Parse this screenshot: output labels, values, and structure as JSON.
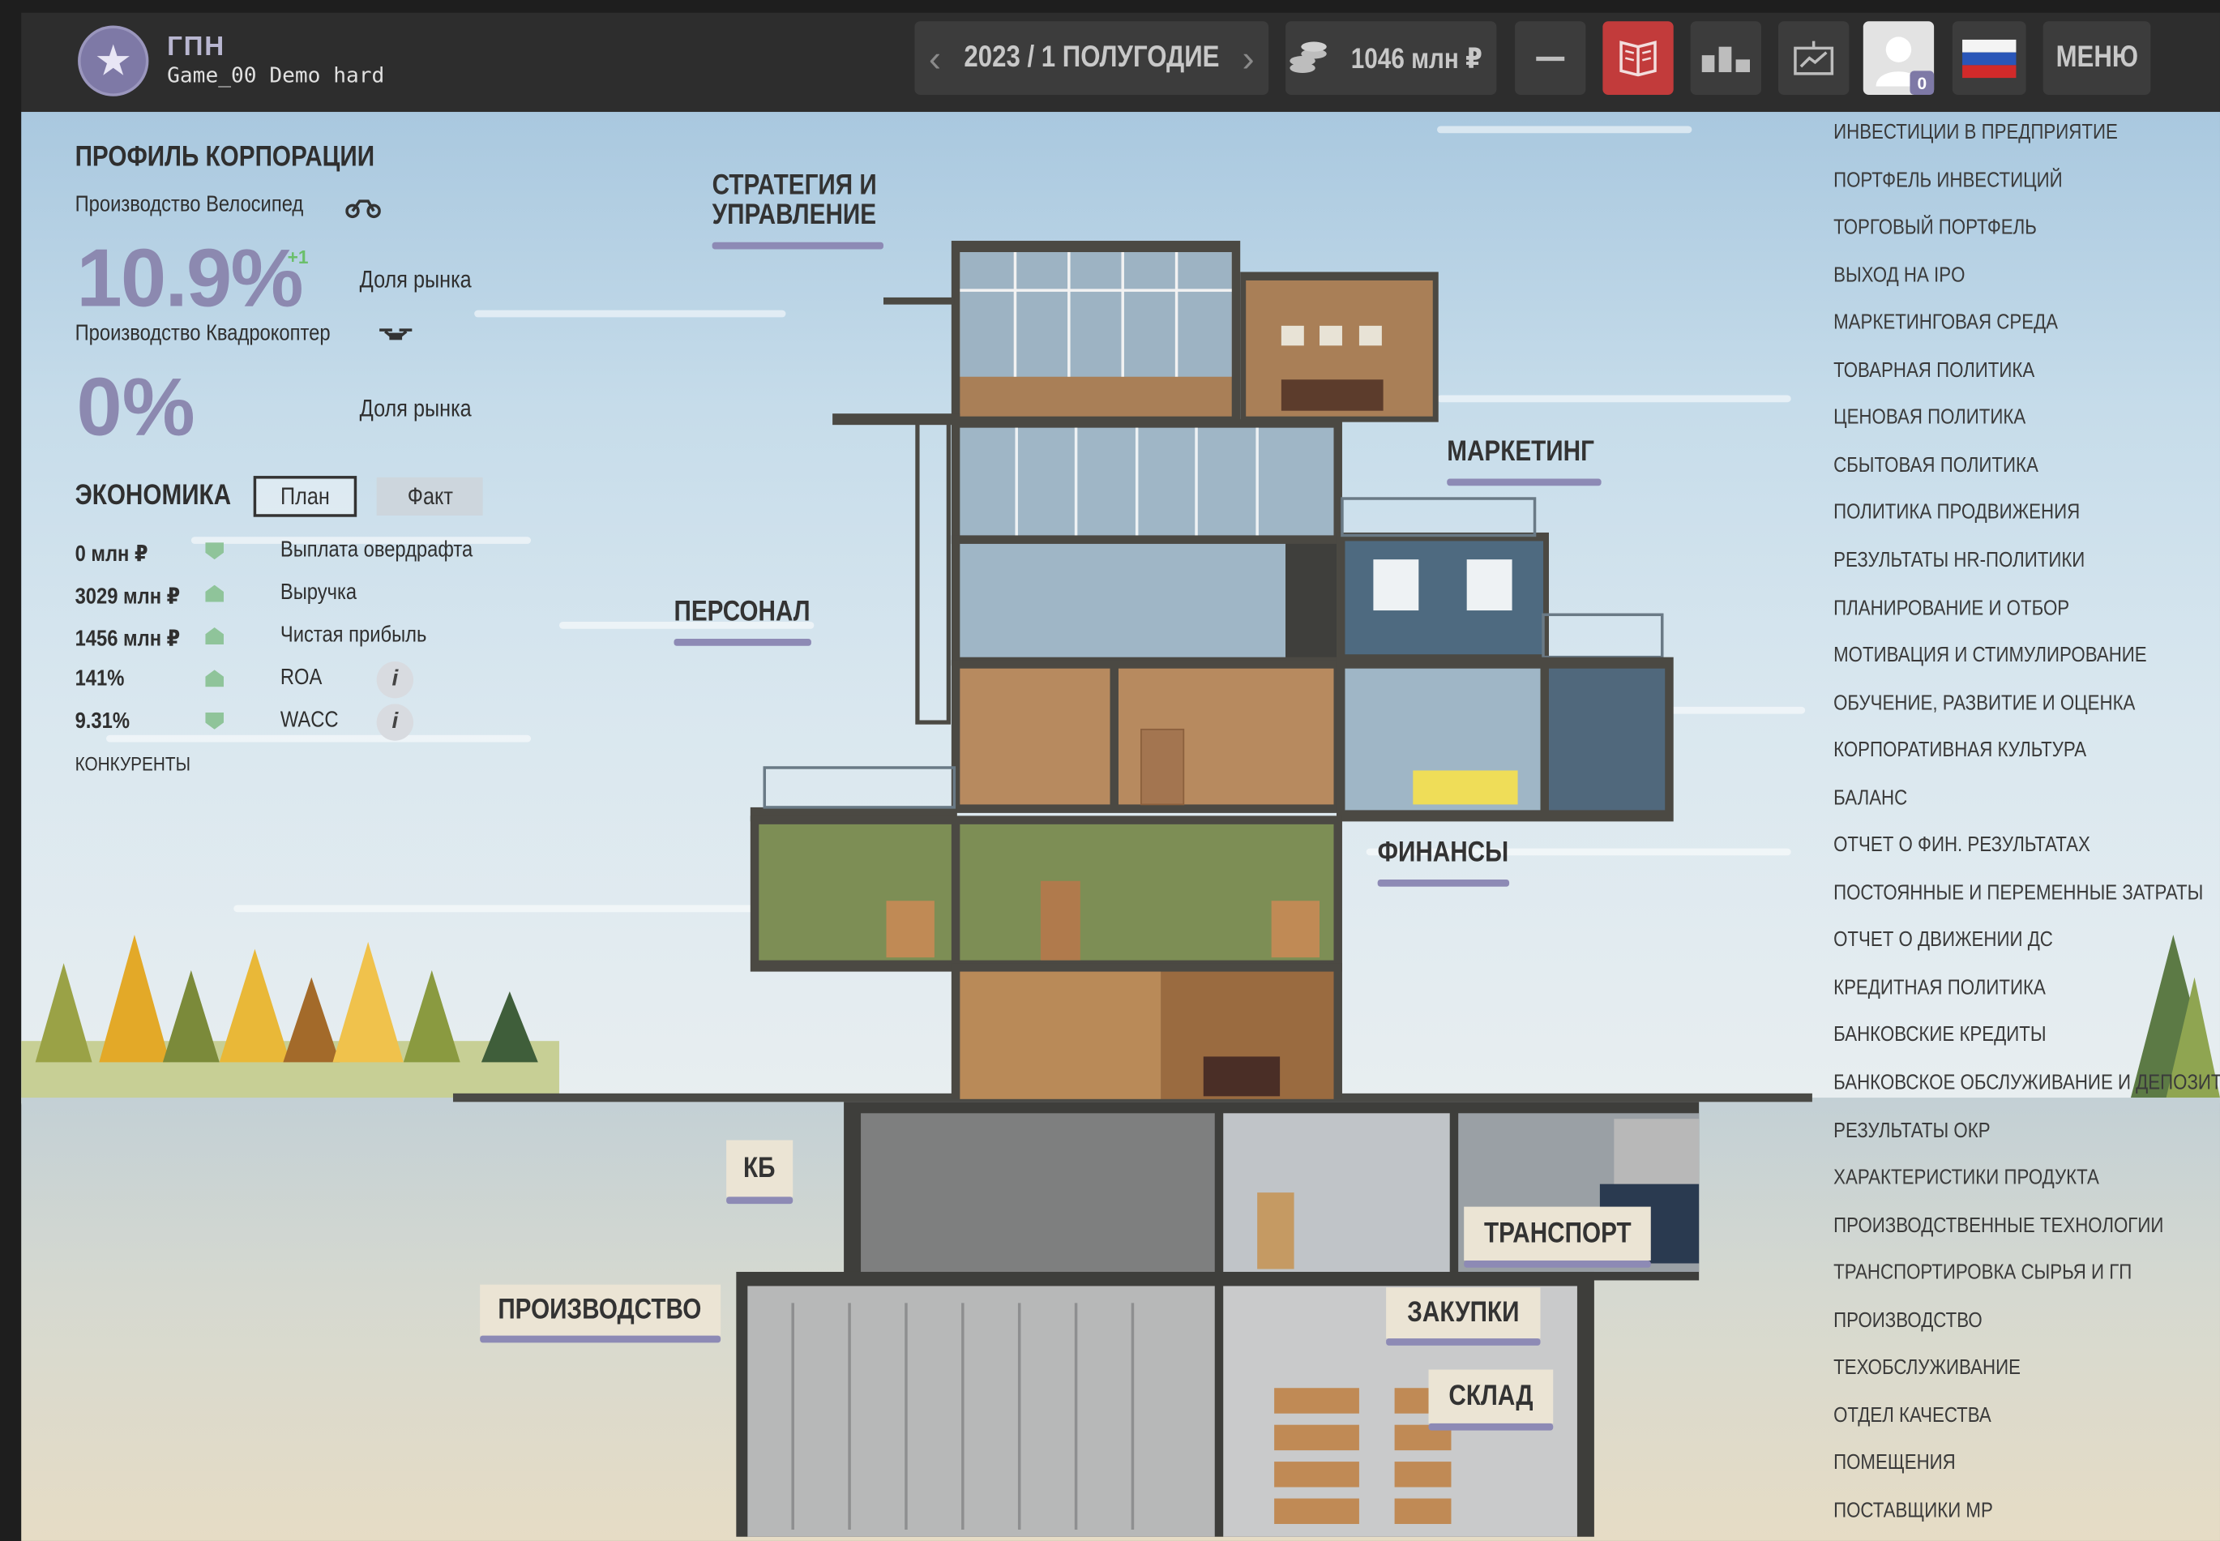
{
  "header": {
    "corp_short": "ГПН",
    "game_name": "Game_00 Demo hard",
    "period": "2023 / 1 ПОЛУГОДИЕ",
    "cash": "1046 млн ₽",
    "avatar_badge": "0",
    "menu_label": "МЕНЮ",
    "colors": {
      "bar": "#2d2d2d",
      "button": "#3c3c3c",
      "active_button": "#c23b3b",
      "brand": "#7e79a6"
    }
  },
  "profile": {
    "title": "ПРОФИЛЬ КОРПОРАЦИИ",
    "products": [
      {
        "name": "Производство Велосипед",
        "share": "10.9%",
        "delta": "+1",
        "share_label": "Доля рынка",
        "icon": "bicycle-icon"
      },
      {
        "name": "Производство Квадрокоптер",
        "share": "0%",
        "delta": "",
        "share_label": "Доля рынка",
        "icon": "drone-icon"
      }
    ]
  },
  "economics": {
    "title": "ЭКОНОМИКА",
    "tab_plan": "План",
    "tab_fact": "Факт",
    "rows": [
      {
        "value": "0 млн ₽",
        "label": "Выплата овердрафта",
        "trend": "down"
      },
      {
        "value": "3029 млн ₽",
        "label": "Выручка",
        "trend": "up"
      },
      {
        "value": "1456 млн ₽",
        "label": "Чистая прибыль",
        "trend": "up"
      },
      {
        "value": "141%",
        "label": "ROA",
        "trend": "up"
      },
      {
        "value": "9.31%",
        "label": "WACC",
        "trend": "down"
      }
    ],
    "competitors": "КОНКУРЕНТЫ"
  },
  "departments": {
    "strategy": "СТРАТЕГИЯ И\nУПРАВЛЕНИЕ",
    "marketing": "МАРКЕТИНГ",
    "personnel": "ПЕРСОНАЛ",
    "finance": "ФИНАНСЫ",
    "kb": "КБ",
    "transport": "ТРАНСПОРТ",
    "production": "ПРОИЗВОДСТВО",
    "purchasing": "ЗАКУПКИ",
    "warehouse": "СКЛАД"
  },
  "side_menu": [
    "ИНВЕСТИЦИИ В ПРЕДПРИЯТИЕ",
    "ПОРТФЕЛЬ ИНВЕСТИЦИЙ",
    "ТОРГОВЫЙ ПОРТФЕЛЬ",
    "ВЫХОД НА IPO",
    "МАРКЕТИНГОВАЯ СРЕДА",
    "ТОВАРНАЯ ПОЛИТИКА",
    "ЦЕНОВАЯ ПОЛИТИКА",
    "СБЫТОВАЯ ПОЛИТИКА",
    "ПОЛИТИКА ПРОДВИЖЕНИЯ",
    "РЕЗУЛЬТАТЫ HR-ПОЛИТИКИ",
    "ПЛАНИРОВАНИЕ И ОТБОР",
    "МОТИВАЦИЯ И СТИМУЛИРОВАНИЕ",
    "ОБУЧЕНИЕ, РАЗВИТИЕ И ОЦЕНКА",
    "КОРПОРАТИВНАЯ КУЛЬТУРА",
    "БАЛАНС",
    "ОТЧЕТ О ФИН. РЕЗУЛЬТАТАХ",
    "ПОСТОЯННЫЕ И ПЕРЕМЕННЫЕ ЗАТРАТЫ",
    "ОТЧЕТ О ДВИЖЕНИИ ДС",
    "КРЕДИТНАЯ ПОЛИТИКА",
    "БАНКОВСКИЕ КРЕДИТЫ",
    "БАНКОВСКОЕ ОБСЛУЖИВАНИЕ И ДЕПОЗИТЫ",
    "РЕЗУЛЬТАТЫ ОКР",
    "ХАРАКТЕРИСТИКИ ПРОДУКТА",
    "ПРОИЗВОДСТВЕННЫЕ ТЕХНОЛОГИИ",
    "ТРАНСПОРТИРОВКА СЫРЬЯ И ГП",
    "ПРОИЗВОДСТВО",
    "ТЕХОБСЛУЖИВАНИЕ",
    "ОТДЕЛ КАЧЕСТВА",
    "ПОМЕЩЕНИЯ",
    "ПОСТАВЩИКИ МР"
  ]
}
